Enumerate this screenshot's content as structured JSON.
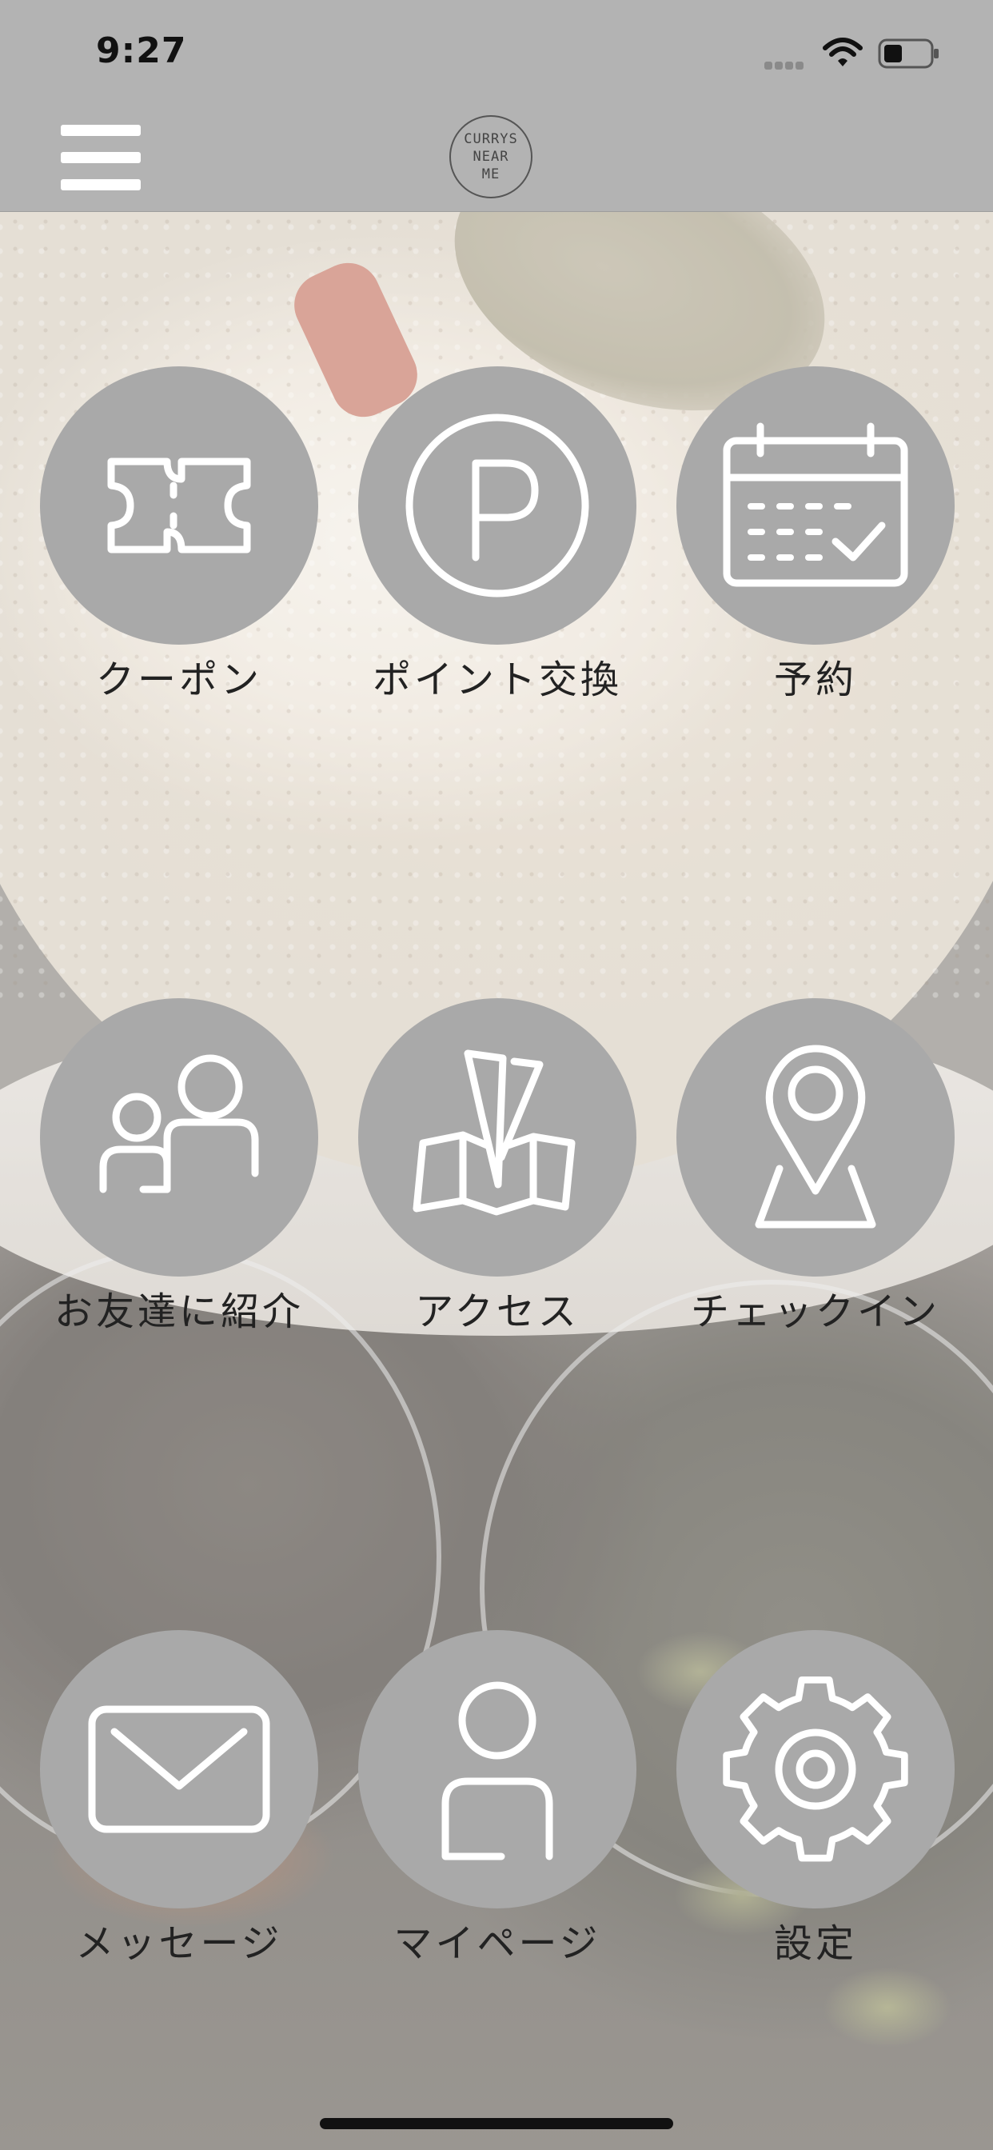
{
  "status_bar": {
    "time": "9:27"
  },
  "header": {
    "logo_lines": [
      "CURRYS",
      "NEAR",
      "ME"
    ]
  },
  "tiles": [
    {
      "label": "クーポン",
      "icon": "ticket-icon"
    },
    {
      "label": "ポイント交換",
      "icon": "points-p-icon"
    },
    {
      "label": "予約",
      "icon": "calendar-check-icon"
    },
    {
      "label": "お友達に紹介",
      "icon": "refer-friends-icon"
    },
    {
      "label": "アクセス",
      "icon": "map-icon"
    },
    {
      "label": "チェックイン",
      "icon": "location-pin-icon"
    },
    {
      "label": "メッセージ",
      "icon": "mail-icon"
    },
    {
      "label": "マイページ",
      "icon": "user-icon"
    },
    {
      "label": "設定",
      "icon": "gear-icon"
    }
  ],
  "colors": {
    "topbar": "#b3b3b3",
    "tile_circle": "#a9a9a9",
    "icon_stroke": "#ffffff",
    "label_text": "#222222"
  }
}
